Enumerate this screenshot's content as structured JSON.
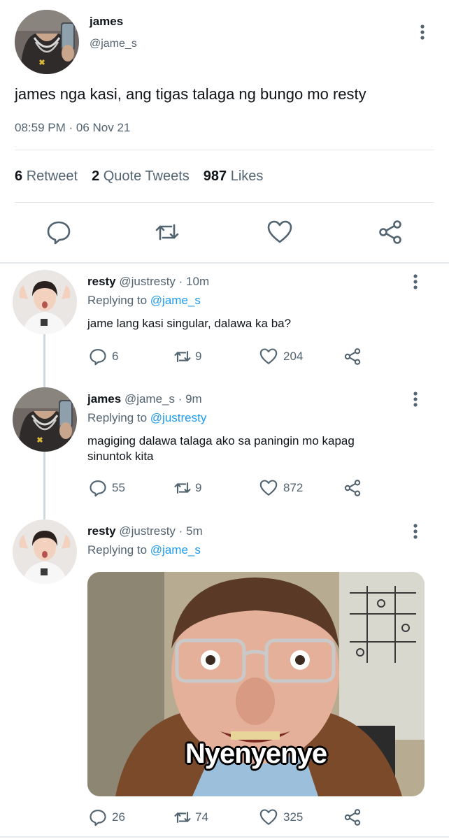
{
  "main_tweet": {
    "name": "james",
    "handle": "@jame_s",
    "text": "james nga kasi, ang tigas talaga ng bungo mo resty",
    "timestamp": "08:59 PM · 06 Nov 21",
    "retweets_count": "6",
    "retweets_label": "Retweet",
    "quotes_count": "2",
    "quotes_label": "Quote Tweets",
    "likes_count": "987",
    "likes_label": "Likes"
  },
  "replies": [
    {
      "name": "resty",
      "meta": "@justresty · 10m",
      "replying_label": "Replying to",
      "replying_to": "@jame_s",
      "text": "jame lang kasi singular, dalawa ka ba?",
      "replies": "6",
      "retweets": "9",
      "likes": "204"
    },
    {
      "name": "james",
      "meta": "@jame_s · 9m",
      "replying_label": "Replying to",
      "replying_to": "@justresty",
      "text": "magiging dalawa talaga ako sa paningin mo kapag sinuntok kita",
      "replies": "55",
      "retweets": "9",
      "likes": "872"
    },
    {
      "name": "resty",
      "meta": "@justresty · 5m",
      "replying_label": "Replying to",
      "replying_to": "@jame_s",
      "media_caption": "Nyenyenye",
      "replies": "26",
      "retweets": "74",
      "likes": "325"
    }
  ],
  "colors": {
    "link": "#1d9bf0",
    "secondary_text": "#536471",
    "primary_text": "#0f1419"
  }
}
